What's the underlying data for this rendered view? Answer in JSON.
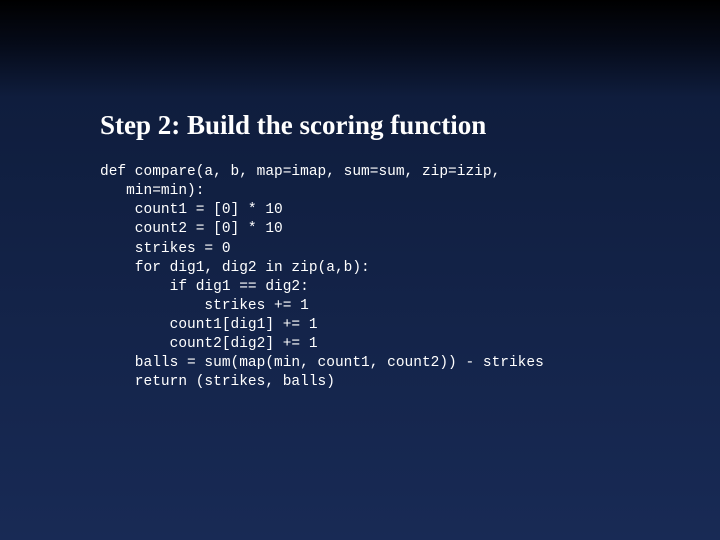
{
  "slide": {
    "title": "Step 2:  Build the scoring function",
    "code_lines": [
      "def compare(a, b, map=imap, sum=sum, zip=izip,",
      "   min=min):",
      "    count1 = [0] * 10",
      "    count2 = [0] * 10",
      "    strikes = 0",
      "    for dig1, dig2 in zip(a,b):",
      "        if dig1 == dig2:",
      "            strikes += 1",
      "        count1[dig1] += 1",
      "        count2[dig2] += 1",
      "    balls = sum(map(min, count1, count2)) - strikes",
      "    return (strikes, balls)"
    ]
  }
}
